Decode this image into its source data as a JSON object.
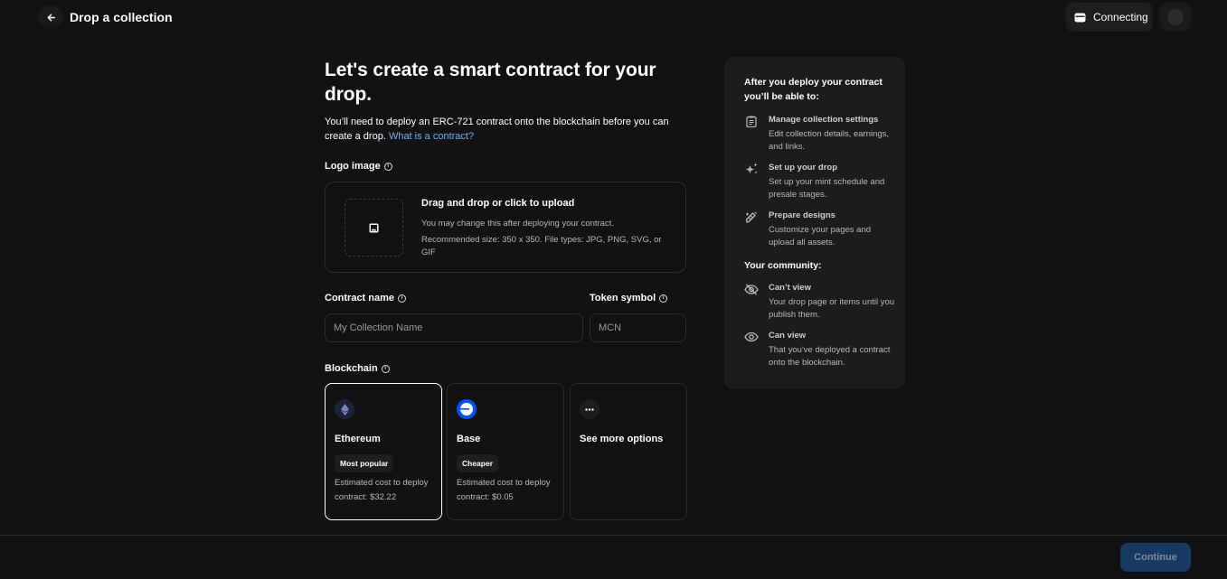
{
  "header": {
    "title": "Drop a collection",
    "wallet_label": "Connecting",
    "icons": {
      "back": "arrow-left-icon",
      "wallet": "wallet-icon",
      "avatar": "avatar"
    }
  },
  "main": {
    "heading": "Let's create a smart contract for your drop.",
    "intro_text": "You’ll need to deploy an ERC-721 contract onto the blockchain before you can create a drop. ",
    "intro_link": "What is a contract?",
    "logo": {
      "label": "Logo image",
      "upload_title": "Drag and drop or click to upload",
      "upload_note": "You may change this after deploying your contract.",
      "upload_requirements": "Recommended size: 350 x 350. File types: JPG, PNG, SVG, or GIF"
    },
    "contract_name": {
      "label": "Contract name",
      "placeholder": "My Collection Name",
      "value": ""
    },
    "token_symbol": {
      "label": "Token symbol",
      "placeholder": "MCN",
      "value": ""
    },
    "blockchain": {
      "label": "Blockchain",
      "options": [
        {
          "name": "Ethereum",
          "badge": "Most popular",
          "cost": "Estimated cost to deploy contract: $32.22",
          "selected": true,
          "icon": "ethereum-icon"
        },
        {
          "name": "Base",
          "badge": "Cheaper",
          "cost": "Estimated cost to deploy contract: $0.05",
          "selected": false,
          "icon": "base-icon"
        },
        {
          "name": "See more options",
          "icon": "more-icon"
        }
      ]
    }
  },
  "sidebar": {
    "heading": "After you deploy your contract you’ll be able to:",
    "items": [
      {
        "title": "Manage collection settings",
        "desc": "Edit collection details, earnings, and links.",
        "icon": "clipboard-icon"
      },
      {
        "title": "Set up your drop",
        "desc": "Set up your mint schedule and presale stages.",
        "icon": "sparkles-icon"
      },
      {
        "title": "Prepare designs",
        "desc": "Customize your pages and upload all assets.",
        "icon": "design-pen-icon"
      }
    ],
    "community_heading": "Your community:",
    "community": [
      {
        "title": "Can’t view",
        "desc": "Your drop page or items until you publish them.",
        "icon": "eye-off-icon"
      },
      {
        "title": "Can view",
        "desc": "That you've deployed a contract onto the blockchain.",
        "icon": "eye-icon"
      }
    ]
  },
  "footer": {
    "continue_label": "Continue",
    "continue_enabled": false
  },
  "colors": {
    "background": "#121212",
    "panel": "#1c1c1c",
    "link": "#6fb1ff",
    "primary_disabled": "#163a61",
    "base_blue": "#0052ff"
  }
}
